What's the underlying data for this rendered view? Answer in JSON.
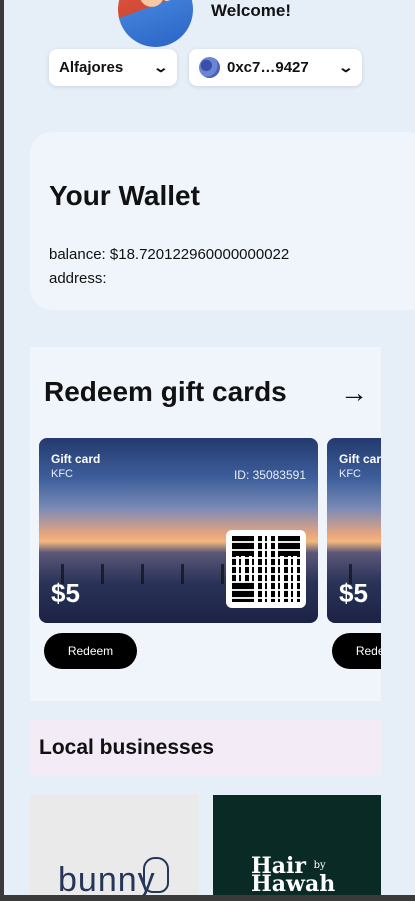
{
  "header": {
    "welcome": "Welcome!",
    "network_label": "Alfajores",
    "account_label": "0xc7…9427"
  },
  "wallet": {
    "title": "Your Wallet",
    "balance_line": "balance: $18.720122960000000022",
    "address_line": "address:"
  },
  "redeem": {
    "title": "Redeem gift cards",
    "cards": [
      {
        "title": "Gift card",
        "brand": "KFC",
        "id": "ID: 35083591",
        "amount": "$5",
        "button": "Redeem"
      },
      {
        "title": "Gift card",
        "brand": "KFC",
        "amount": "$5",
        "button": "Redeem"
      }
    ]
  },
  "local": {
    "title": "Local businesses",
    "businesses": [
      {
        "name": "bunny"
      },
      {
        "name": "Hair by Hawah"
      }
    ]
  },
  "colors": {
    "background": "#e6eff7",
    "card": "#f0f5fb",
    "local_header": "#f3ebf6",
    "button": "#000000"
  }
}
